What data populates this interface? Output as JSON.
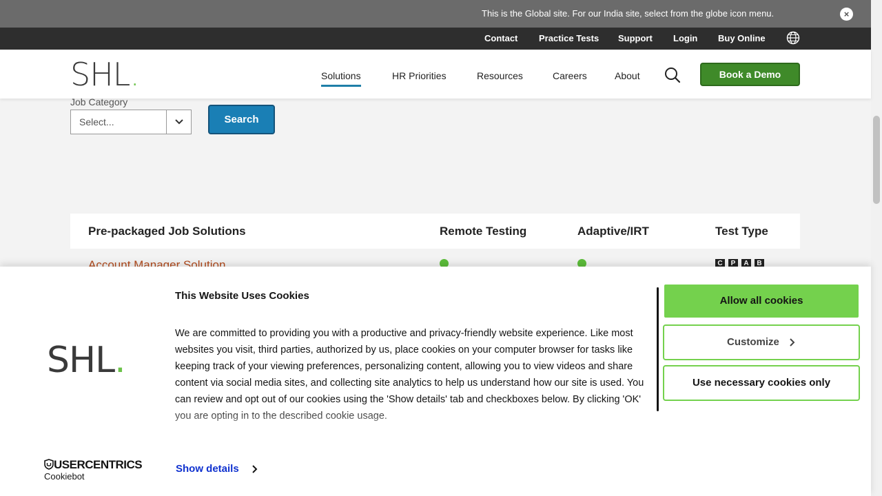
{
  "notice": {
    "text": "This is the Global site. For our India site, select from the globe icon menu.",
    "close_glyph": "×"
  },
  "utility_nav": {
    "items": [
      "Contact",
      "Practice Tests",
      "Support",
      "Login",
      "Buy Online"
    ]
  },
  "header": {
    "logo_text": "SHL",
    "logo_dot": ".",
    "nav": [
      "Solutions",
      "HR Priorities",
      "Resources",
      "Careers",
      "About"
    ],
    "active_nav": "Solutions",
    "demo_button": "Book a Demo"
  },
  "filter": {
    "label": "Job Category",
    "select_value": "Select...",
    "search_button": "Search"
  },
  "table": {
    "headers": [
      "Pre-packaged Job Solutions",
      "Remote Testing",
      "Adaptive/IRT",
      "Test Type"
    ],
    "rows": [
      {
        "name": "Account Manager Solution",
        "remote_testing": true,
        "adaptive": true,
        "test_types": [
          "C",
          "P",
          "A",
          "B"
        ]
      }
    ]
  },
  "cookie_banner": {
    "title": "This Website Uses Cookies",
    "body": "We are committed to providing you with a productive and privacy-friendly website experience. Like most websites you visit, third parties, authorized by us, place cookies on your computer browser for tasks like keeping track of your viewing preferences, personalizing content, allowing you to view videos and share content via social media sites, and collecting site analytics to help us understand how our site is used. You can review and opt out of our cookies using the 'Show details' tab and checkboxes below. By clicking 'OK' you are opting in to the described cookie usage.",
    "logo_text": "SHL",
    "logo_dot": ".",
    "allow_all": "Allow all cookies",
    "customize": "Customize",
    "necessary_only": "Use necessary cookies only",
    "show_details": "Show details",
    "provider": "USERCENTRICS",
    "provider_product": "Cookiebot"
  },
  "colors": {
    "accent_green": "#74d14d",
    "demo_green": "#3f8a29",
    "search_blue": "#1a7fb5",
    "link_orange": "#b24a1c",
    "show_details_blue": "#1032cf"
  }
}
